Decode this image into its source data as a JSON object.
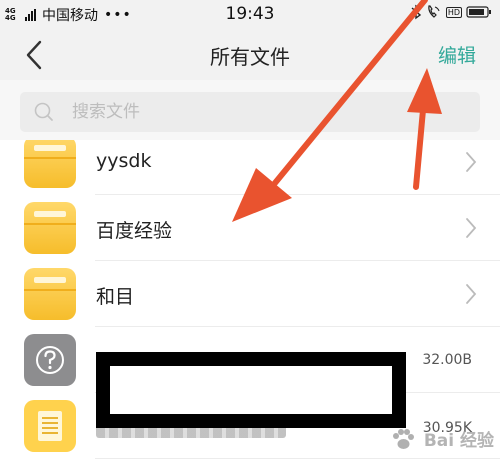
{
  "status_bar": {
    "network_top": "4G",
    "network_bottom": "4G",
    "carrier": "中国移动",
    "more": "•••",
    "time": "19:43",
    "hd": "HD"
  },
  "header": {
    "title": "所有文件",
    "edit_label": "编辑"
  },
  "search": {
    "placeholder": "搜索文件"
  },
  "files": [
    {
      "name": "yysdk",
      "type": "folder"
    },
    {
      "name": "百度经验",
      "type": "folder"
    },
    {
      "name": "和目",
      "type": "folder"
    },
    {
      "name": "",
      "type": "unknown",
      "size": "32.00B"
    },
    {
      "name": "",
      "type": "document",
      "size": "30.95K"
    }
  ],
  "watermark": {
    "text": "Bai 经验"
  },
  "colors": {
    "accent": "#33a99a",
    "folder": "#f6bd2b",
    "annotation_arrow": "#e9532f"
  }
}
